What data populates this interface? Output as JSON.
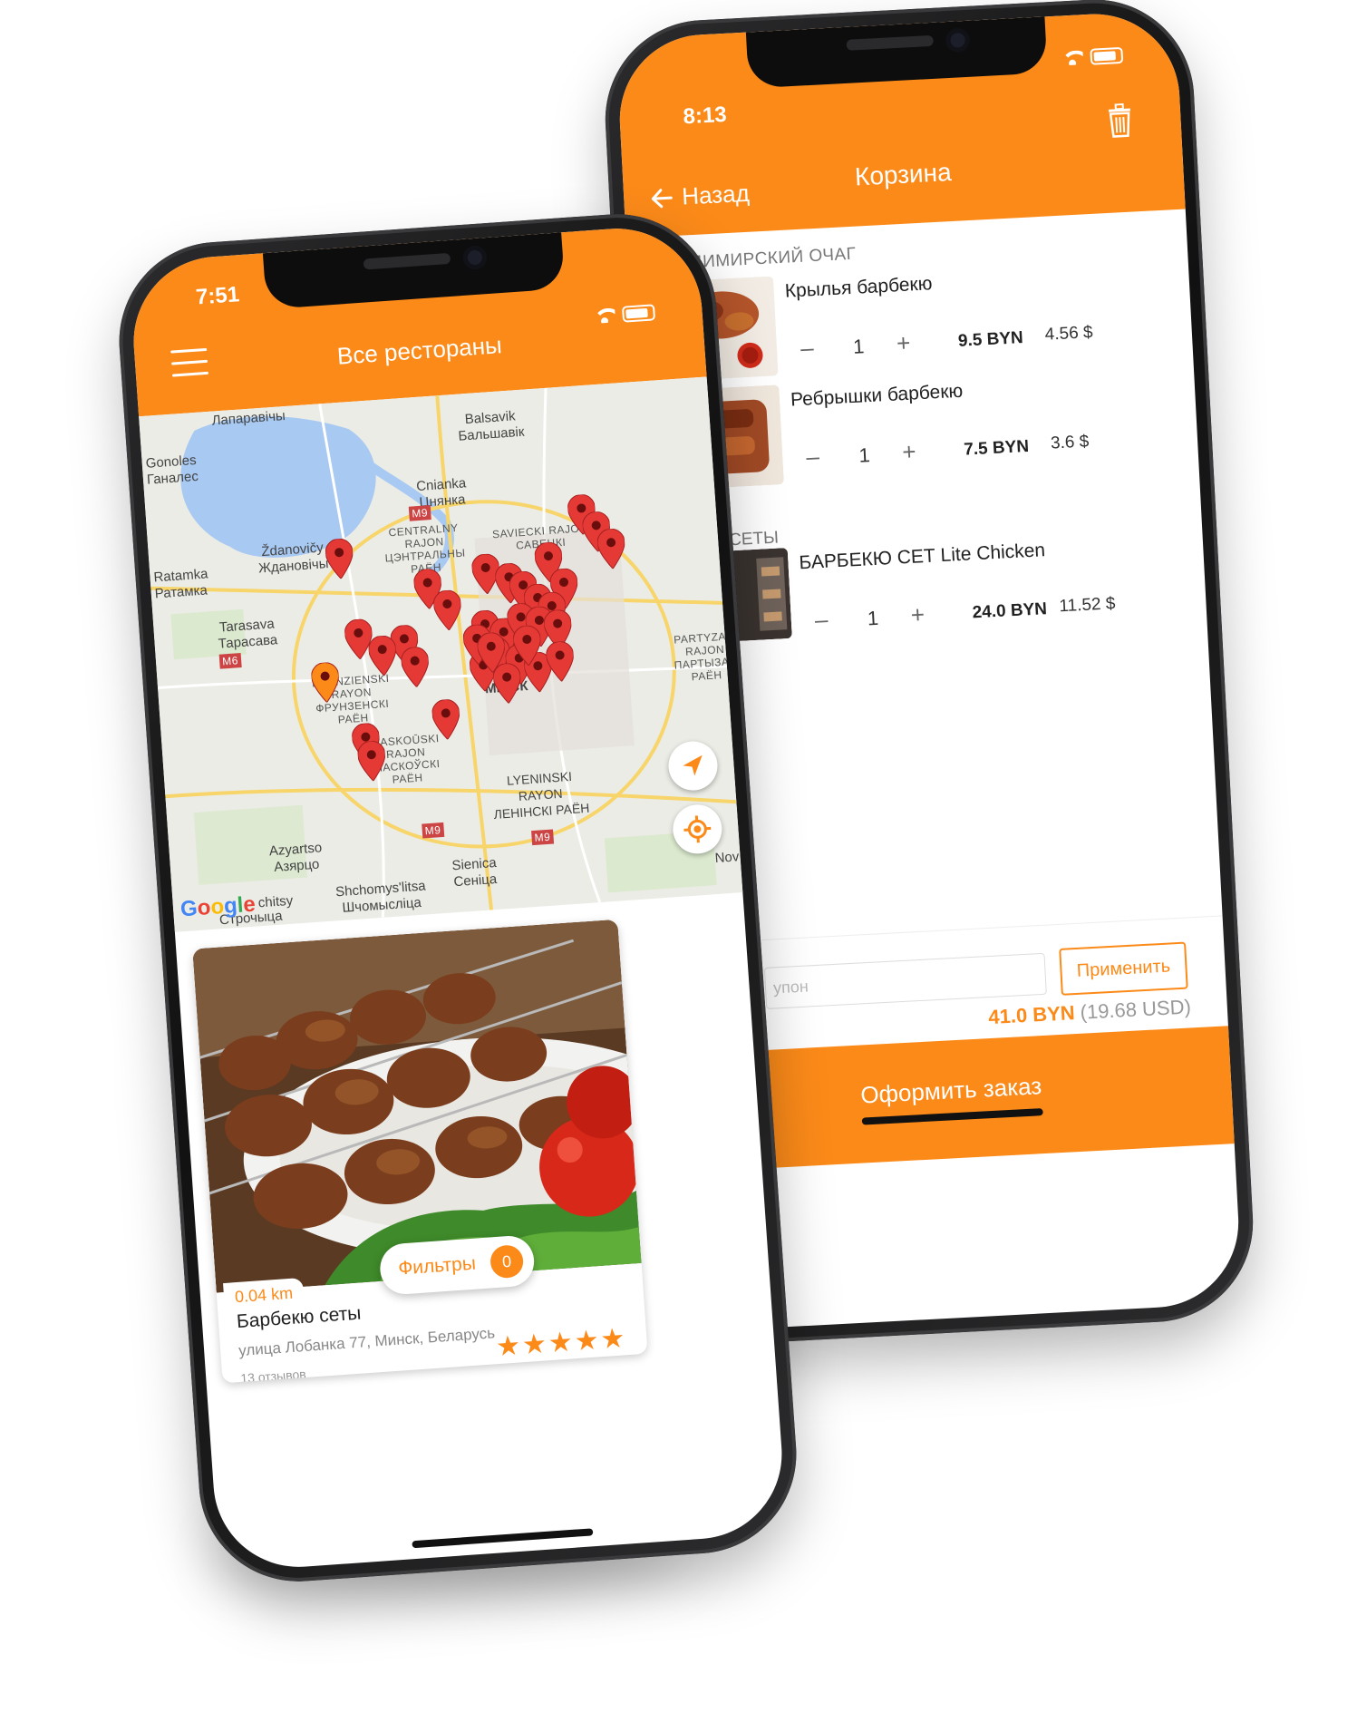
{
  "colors": {
    "accent": "#fb8a19",
    "pin": "#e53935",
    "pin_selected": "#fb8a19"
  },
  "cart_screen": {
    "status_time": "8:13",
    "back_label": "Назад",
    "title": "Корзина",
    "trash_icon": "trash-icon",
    "restaurant": "ВЛАДИМИРСКИЙ ОЧАГ",
    "section": "СЕТЫ",
    "items": [
      {
        "name": "Крылья барбекю",
        "minus": "–",
        "qty": "1",
        "plus": "+",
        "price_byn": "9.5 BYN",
        "price_usd": "4.56 $"
      },
      {
        "name": "Ребрышки барбекю",
        "minus": "–",
        "qty": "1",
        "plus": "+",
        "price_byn": "7.5 BYN",
        "price_usd": "3.6 $"
      },
      {
        "name": "БАРБЕКЮ СЕТ Lite Chicken",
        "minus": "–",
        "qty": "1",
        "plus": "+",
        "price_byn": "24.0 BYN",
        "price_usd": "11.52 $"
      }
    ],
    "coupon_placeholder": "упон",
    "apply_label": "Применить",
    "total_byn": "41.0 BYN",
    "total_usd": "(19.68 USD)",
    "checkout_label": "Оформить заказ"
  },
  "map_screen": {
    "status_time": "7:51",
    "title": "Все рестораны",
    "map_labels": [
      "Лапаравічы",
      "Gonoles\nГаналес",
      "Balsavik\nБальшавік",
      "Cnianka\nЦнянка",
      "Ždanovičy\nЖдановічы",
      "Ratamka\nРатамка",
      "Tarasava\nТарасава",
      "CENTRALNY\nRAJON\nЦЭНТРАЛЬНЫ\nРАЁН",
      "SAVIECKI RAJON\nСАВЕЦКІ",
      "FRUNZIENSKI\nRAYON\nФРУНЗЕНСКІ\nРАЁН",
      "MASKOŪSKI\nRAJON\nМАСКОЎСКІ\nРАЁН",
      "PARTYZAN\nRAJON\nПАРТЫЗАН\nРАЁН",
      "LYENINSKI\nRAYON\nЛЕНІНСКІ РАЁН",
      "Azyartso\nАзярцо",
      "Shchomys'litsa\nШчомысліца",
      "Sienica\nСеніца",
      "Строчыца",
      "МІНСК",
      "M9",
      "M6",
      "M9",
      "M9",
      "Nov"
    ],
    "map_label_strokes": [
      "chitsy"
    ],
    "google_logo": [
      "G",
      "o",
      "o",
      "g",
      "l",
      "e"
    ],
    "card": {
      "distance": "0.04 km",
      "name": "Барбекю сеты",
      "address": "улица Лобанка 77, Минск, Беларусь",
      "reviews": "13 отзывов",
      "stars": "★★★★★",
      "rating": 5
    },
    "filters_label": "Фильтры",
    "filters_count": "0"
  }
}
